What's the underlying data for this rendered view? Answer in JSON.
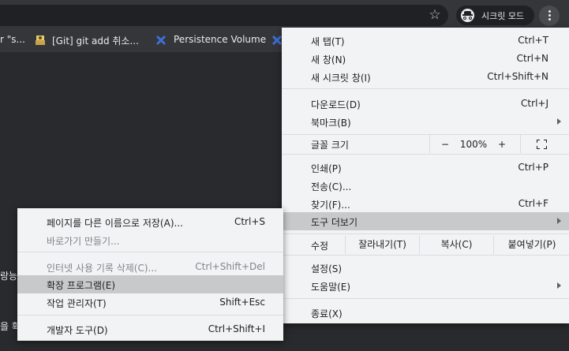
{
  "toolbar": {
    "incognito_label": "시크릿 모드",
    "star_icon": "star-icon",
    "menu_icon": "kebab-menu-icon"
  },
  "bookmarks": {
    "items": [
      {
        "label": "r \"s..."
      },
      {
        "label": "[Git] git add 취소..."
      },
      {
        "label": "Persistence Volume"
      }
    ]
  },
  "page": {
    "edge_text_1": "랑능",
    "edge_text_2": "을 확"
  },
  "main_menu": {
    "new_tab": {
      "label": "새 탭(T)",
      "shortcut": "Ctrl+T"
    },
    "new_window": {
      "label": "새 창(N)",
      "shortcut": "Ctrl+N"
    },
    "new_incognito": {
      "label": "새 시크릿 창(I)",
      "shortcut": "Ctrl+Shift+N"
    },
    "downloads": {
      "label": "다운로드(D)",
      "shortcut": "Ctrl+J"
    },
    "bookmarks": {
      "label": "북마크(B)"
    },
    "zoom": {
      "label": "글꼴 크기",
      "minus": "−",
      "value": "100%",
      "plus": "+"
    },
    "print": {
      "label": "인쇄(P)",
      "shortcut": "Ctrl+P"
    },
    "cast": {
      "label": "전송(C)..."
    },
    "find": {
      "label": "찾기(F)...",
      "shortcut": "Ctrl+F"
    },
    "more_tools": {
      "label": "도구 더보기"
    },
    "edit": {
      "label": "수정",
      "cut": "잘라내기(T)",
      "copy": "복사(C)",
      "paste": "붙여넣기(P)"
    },
    "settings": {
      "label": "설정(S)"
    },
    "help": {
      "label": "도움말(E)"
    },
    "exit": {
      "label": "종료(X)"
    }
  },
  "submenu": {
    "save_page": {
      "label": "페이지를 다른 이름으로 저장(A)...",
      "shortcut": "Ctrl+S"
    },
    "create_shortcut": {
      "label": "바로가기 만들기..."
    },
    "clear_data": {
      "label": "인터넷 사용 기록 삭제(C)...",
      "shortcut": "Ctrl+Shift+Del"
    },
    "extensions": {
      "label": "확장 프로그램(E)"
    },
    "task_manager": {
      "label": "작업 관리자(T)",
      "shortcut": "Shift+Esc"
    },
    "dev_tools": {
      "label": "개발자 도구(D)",
      "shortcut": "Ctrl+Shift+I"
    }
  },
  "colors": {
    "menu_bg": "#f1f3f4",
    "highlight": "#c8c9cb",
    "browser_frame": "#35363a",
    "page_bg": "#292a2d"
  }
}
